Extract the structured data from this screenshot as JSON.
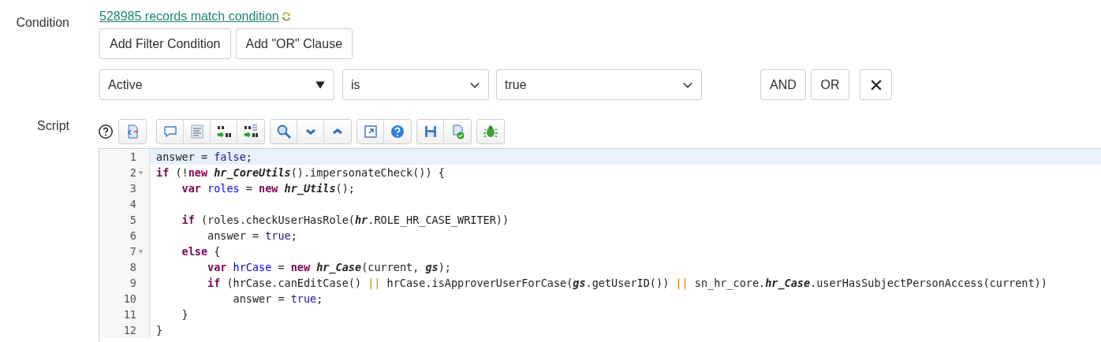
{
  "condition": {
    "label": "Condition",
    "match_link": "528985 records match condition",
    "buttons": [
      "Add Filter Condition",
      "Add \"OR\" Clause"
    ],
    "filter": {
      "field": "Active",
      "operator": "is",
      "value": "true",
      "buttons": [
        "AND",
        "OR"
      ]
    }
  },
  "script": {
    "label": "Script",
    "lines": [
      {
        "number": "1",
        "foldable": false,
        "active": true,
        "tokens": [
          {
            "kind": "plain",
            "text": "answer = "
          },
          {
            "kind": "atom",
            "text": "false"
          },
          {
            "kind": "plain",
            "text": ";"
          }
        ]
      },
      {
        "number": "2",
        "foldable": true,
        "active": false,
        "tokens": [
          {
            "kind": "keyword",
            "text": "if"
          },
          {
            "kind": "plain",
            "text": " (!"
          },
          {
            "kind": "keyword",
            "text": "new "
          },
          {
            "kind": "class",
            "text": "hr_CoreUtils"
          },
          {
            "kind": "plain",
            "text": "().impersonateCheck()) {"
          }
        ]
      },
      {
        "number": "3",
        "foldable": false,
        "active": false,
        "tokens": [
          {
            "kind": "keyword",
            "text": "    var "
          },
          {
            "kind": "def",
            "text": "roles"
          },
          {
            "kind": "plain",
            "text": " = "
          },
          {
            "kind": "keyword",
            "text": "new "
          },
          {
            "kind": "class",
            "text": "hr_Utils"
          },
          {
            "kind": "plain",
            "text": "();"
          }
        ]
      },
      {
        "number": "4",
        "foldable": false,
        "active": false
      },
      {
        "number": "5",
        "foldable": false,
        "active": false,
        "tokens": [
          {
            "kind": "keyword",
            "text": "    if"
          },
          {
            "kind": "plain",
            "text": " (roles.checkUserHasRole("
          },
          {
            "kind": "class",
            "text": "hr"
          },
          {
            "kind": "plain",
            "text": ".ROLE_HR_CASE_WRITER))"
          }
        ]
      },
      {
        "number": "6",
        "foldable": false,
        "active": false,
        "tokens": [
          {
            "kind": "plain",
            "text": "        answer = "
          },
          {
            "kind": "atom",
            "text": "true"
          },
          {
            "kind": "plain",
            "text": ";"
          }
        ]
      },
      {
        "number": "7",
        "foldable": true,
        "active": false,
        "tokens": [
          {
            "kind": "keyword",
            "text": "    else"
          },
          {
            "kind": "plain",
            "text": " {"
          }
        ]
      },
      {
        "number": "8",
        "foldable": false,
        "active": false,
        "tokens": [
          {
            "kind": "keyword",
            "text": "        var "
          },
          {
            "kind": "def",
            "text": "hrCase"
          },
          {
            "kind": "plain",
            "text": " = "
          },
          {
            "kind": "keyword",
            "text": "new "
          },
          {
            "kind": "class",
            "text": "hr_Case"
          },
          {
            "kind": "plain",
            "text": "(current, "
          },
          {
            "kind": "class",
            "text": "gs"
          },
          {
            "kind": "plain",
            "text": ");"
          }
        ]
      },
      {
        "number": "9",
        "foldable": false,
        "active": false,
        "tokens": [
          {
            "kind": "keyword",
            "text": "        if"
          },
          {
            "kind": "plain",
            "text": " (hrCase.canEditCase() "
          },
          {
            "kind": "operator",
            "text": "||"
          },
          {
            "kind": "plain",
            "text": " hrCase.isApproverUserForCase("
          },
          {
            "kind": "class",
            "text": "gs"
          },
          {
            "kind": "plain",
            "text": ".getUserID()) "
          },
          {
            "kind": "operator",
            "text": "||"
          },
          {
            "kind": "plain",
            "text": " sn_hr_core."
          },
          {
            "kind": "class",
            "text": "hr_Case"
          },
          {
            "kind": "plain",
            "text": ".userHasSubjectPersonAccess(current))"
          }
        ]
      },
      {
        "number": "10",
        "foldable": false,
        "active": false,
        "tokens": [
          {
            "kind": "plain",
            "text": "            answer = "
          },
          {
            "kind": "atom",
            "text": "true"
          },
          {
            "kind": "plain",
            "text": ";"
          }
        ]
      },
      {
        "number": "11",
        "foldable": false,
        "active": false,
        "tokens": [
          {
            "kind": "plain",
            "text": "    }"
          }
        ]
      },
      {
        "number": "12",
        "foldable": false,
        "active": false,
        "tokens": [
          {
            "kind": "plain",
            "text": "}"
          }
        ]
      }
    ]
  }
}
